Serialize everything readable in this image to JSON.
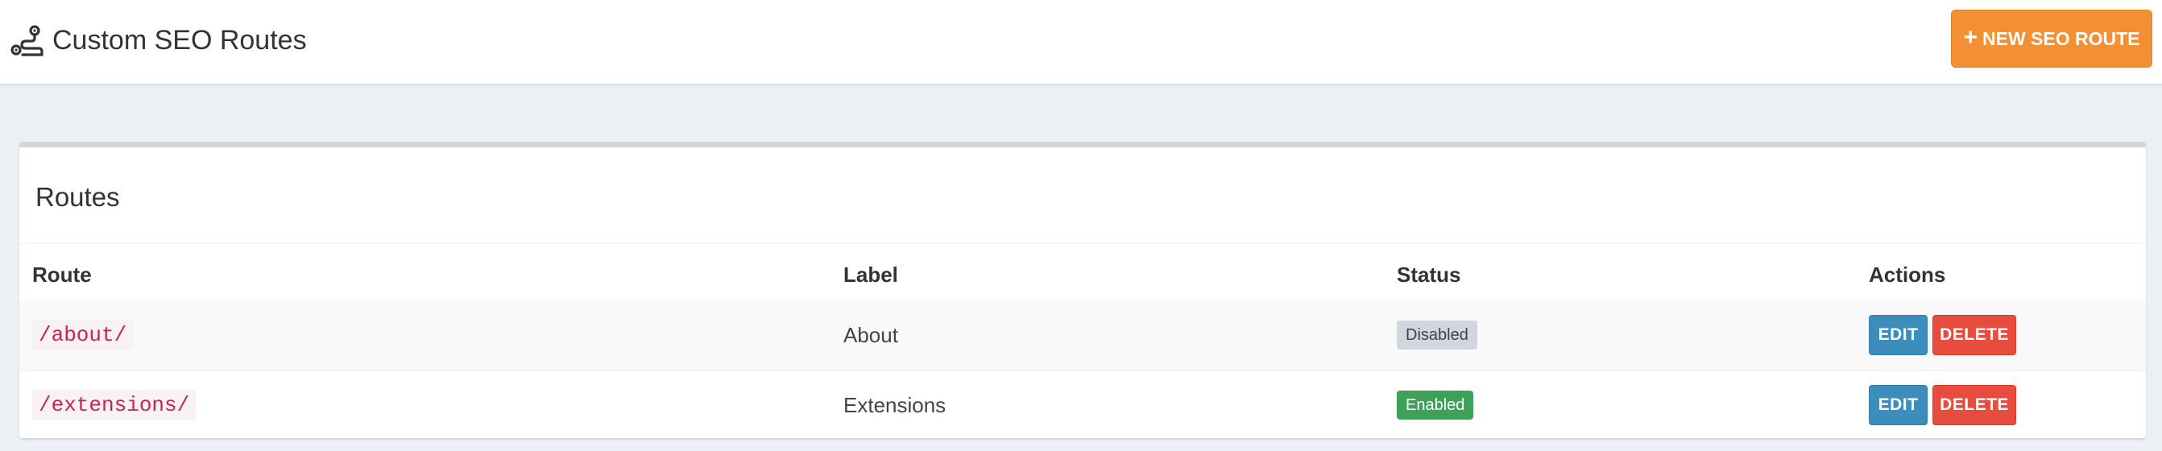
{
  "header": {
    "title": "Custom SEO Routes",
    "icon": "route-icon",
    "new_button_label": "NEW SEO ROUTE",
    "new_button_icon": "plus-icon",
    "accent_color": "#f39034"
  },
  "panel": {
    "title": "Routes",
    "columns": [
      "Route",
      "Label",
      "Status",
      "Actions"
    ]
  },
  "routes": [
    {
      "route": "/about/",
      "label": "About",
      "status": "Disabled",
      "edit_label": "EDIT",
      "delete_label": "DELETE"
    },
    {
      "route": "/extensions/",
      "label": "Extensions",
      "status": "Enabled",
      "edit_label": "EDIT",
      "delete_label": "DELETE"
    }
  ],
  "colors": {
    "edit": "#3c8dbc",
    "delete": "#e74c3c",
    "enabled": "#3da257",
    "disabled": "#d2d6de"
  }
}
